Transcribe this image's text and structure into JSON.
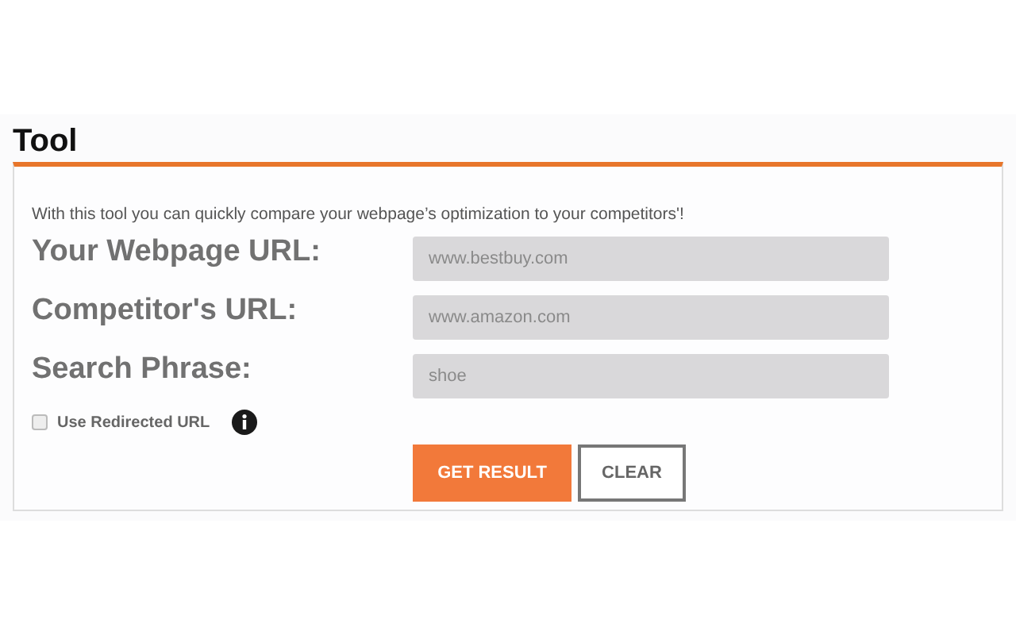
{
  "title": "Tool",
  "intro": "With this tool you can quickly compare your webpage’s optimization to your competitors'!",
  "fields": [
    {
      "label": "Your Webpage URL:",
      "placeholder": "www.bestbuy.com"
    },
    {
      "label": "Competitor's URL:",
      "placeholder": "www.amazon.com"
    },
    {
      "label": "Search Phrase:",
      "placeholder": "shoe"
    }
  ],
  "option": {
    "label": "Use Redirected URL",
    "checked": false
  },
  "buttons": [
    {
      "label": "GET RESULT",
      "kind": "primary"
    },
    {
      "label": "CLEAR",
      "kind": "secondary"
    }
  ]
}
